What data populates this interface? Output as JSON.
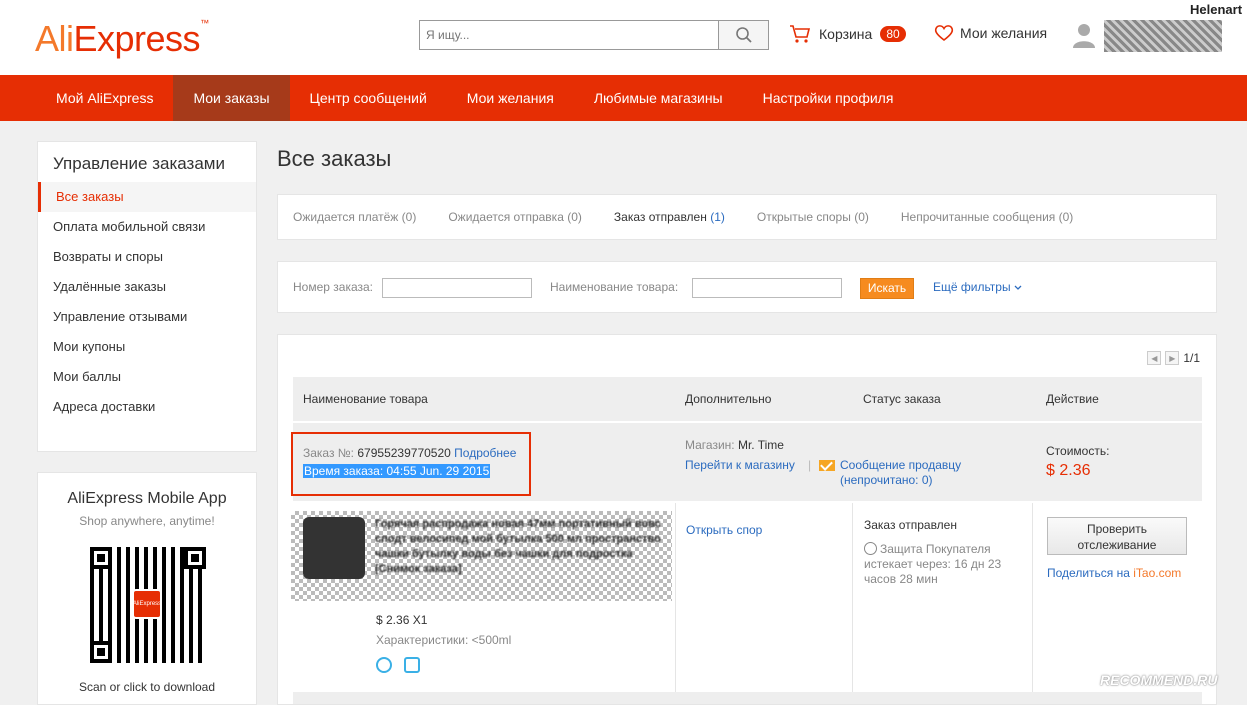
{
  "header": {
    "logo_ali": "Ali",
    "logo_express": "Express",
    "logo_tm": "™",
    "search_placeholder": "Я ищу...",
    "cart_label": "Корзина",
    "cart_count": "80",
    "wishlist_label": "Мои желания",
    "username_top": "Helenart"
  },
  "nav": {
    "items": [
      "Мой AliExpress",
      "Мои заказы",
      "Центр сообщений",
      "Мои желания",
      "Любимые магазины",
      "Настройки профиля"
    ],
    "active_index": 1
  },
  "sidebar": {
    "title": "Управление заказами",
    "items": [
      "Все заказы",
      "Оплата мобильной связи",
      "Возвраты и споры",
      "Удалённые заказы",
      "Управление отзывами",
      "Мои купоны",
      "Мои баллы",
      "Адреса доставки"
    ]
  },
  "app_promo": {
    "title": "AliExpress Mobile App",
    "subtitle": "Shop anywhere, anytime!",
    "qr_logo": "AliExpress",
    "cta": "Scan or click to download"
  },
  "main": {
    "title": "Все заказы",
    "tabs": [
      {
        "label": "Ожидается платёж",
        "count": "(0)"
      },
      {
        "label": "Ожидается отправка",
        "count": "(0)"
      },
      {
        "label": "Заказ отправлен",
        "count": "(1)"
      },
      {
        "label": "Открытые споры",
        "count": "(0)"
      },
      {
        "label": "Непрочитанные сообщения",
        "count": "(0)"
      }
    ],
    "filters": {
      "order_no_label": "Номер заказа:",
      "product_label": "Наименование товара:",
      "search_button": "Искать",
      "more_filters": "Ещё фильтры"
    },
    "pager": "1/1",
    "columns": [
      "Наименование товара",
      "Дополнительно",
      "Статус заказа",
      "Действие"
    ],
    "order": {
      "number_label": "Заказ №:",
      "number": "67955239770520",
      "details_link": "Подробнее",
      "time": "Время заказа: 04:55 Jun. 29 2015",
      "store_label": "Магазин:",
      "store_name": "Mr. Time",
      "store_link": "Перейти к магазину",
      "separator": "|",
      "message_link": "Сообщение продавцу",
      "unread_prefix": "(непрочитано: ",
      "unread_count": "0",
      "unread_suffix": ")",
      "cost_label": "Стоимость:",
      "cost": "$ 2.36",
      "product_title": "Горячая распродажа новая 47мм портативный вовс сподт велосипед мой бутылка 500 мл пространство чашки бутылку воды без чашки для подростка",
      "product_snapshot": "[Снимок заказа]",
      "item_price": "$ 2.36 X1",
      "item_attrs": "Характеристики: <500ml",
      "dispute_link": "Открыть спор",
      "status": "Заказ отправлен",
      "protection": "Защита Покупателя истекает через: 16 дн 23 часов 28 мин",
      "track_button": "Проверить отслеживание",
      "share_prefix": "Поделиться на ",
      "share_site": "iTao.com"
    }
  },
  "watermark": "RECOMMEND.RU"
}
